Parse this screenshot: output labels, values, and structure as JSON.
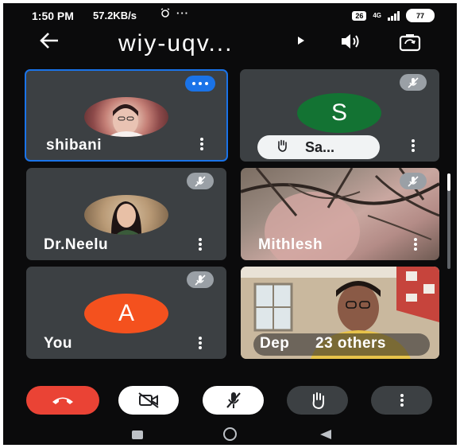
{
  "status_bar": {
    "time": "1:50 PM",
    "speed": "57.2KB/s",
    "alarm_icon": "alarm-icon",
    "more": "···",
    "data_badge": "26",
    "network": "4G",
    "battery": "77"
  },
  "header": {
    "title": "wiy-uqv...",
    "back_icon": "back-arrow-icon",
    "caret_icon": "play-caret-icon",
    "audio_icon": "speaker-icon",
    "camera_icon": "camera-flip-icon"
  },
  "tiles": [
    {
      "name": "shibani",
      "speaking": true
    },
    {
      "name": "Sa...",
      "initial": "S",
      "hand_raised": true
    },
    {
      "name": "Dr.Neelu"
    },
    {
      "name": "Mithlesh"
    },
    {
      "name": "You",
      "initial": "A"
    },
    {
      "name": "Dep",
      "others": "23 others"
    }
  ],
  "controls": [
    "end-call-icon",
    "camera-off-icon",
    "mic-off-icon",
    "raise-hand-icon",
    "more-options-icon"
  ],
  "nav": [
    "recents-icon",
    "home-icon",
    "back-icon"
  ],
  "colors": {
    "accent_blue": "#1a73e8",
    "end_call_red": "#ea4335",
    "avatar_green": "#137333",
    "avatar_orange": "#f4511e",
    "tile_bg": "#3c4043"
  }
}
